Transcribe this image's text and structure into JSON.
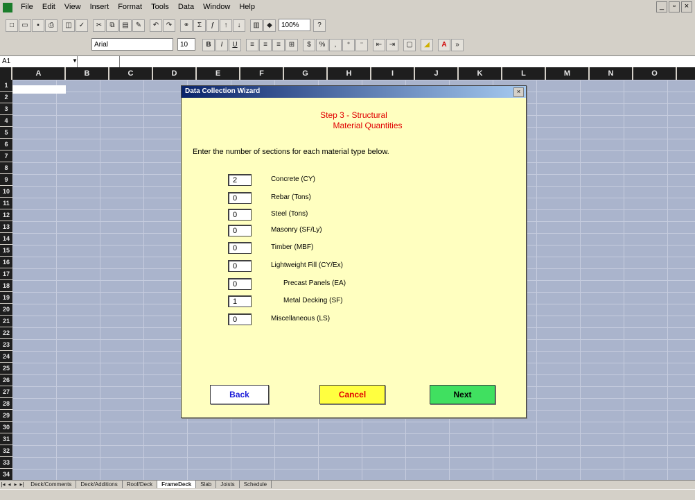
{
  "menubar": {
    "items": [
      "File",
      "Edit",
      "View",
      "Insert",
      "Format",
      "Tools",
      "Data",
      "Window",
      "Help"
    ]
  },
  "toolbar": {
    "zoom": "100%",
    "font_name": "Arial",
    "font_size": "10"
  },
  "formula_bar": {
    "name_box": "A1",
    "value": ""
  },
  "columns": [
    "A",
    "B",
    "C",
    "D",
    "E",
    "F",
    "G",
    "H",
    "I",
    "J",
    "K",
    "L",
    "M",
    "N",
    "O"
  ],
  "rows": [
    "1",
    "2",
    "3",
    "4",
    "5",
    "6",
    "7",
    "8",
    "9",
    "10",
    "11",
    "12",
    "13",
    "14",
    "15",
    "16",
    "17",
    "18",
    "19",
    "20",
    "21",
    "22",
    "23",
    "24",
    "25",
    "26",
    "27",
    "28",
    "29",
    "30",
    "31",
    "32",
    "33",
    "34"
  ],
  "sheet_tabs": {
    "items": [
      "Deck/Comments",
      "Deck/Additions",
      "Roof/Deck",
      "FrameDeck",
      "Slab",
      "Joists",
      "Schedule"
    ],
    "active_index": 3
  },
  "dialog": {
    "title": "Data Collection Wizard",
    "heading_line1": "Step 3 - Structural",
    "heading_line2": "Material Quantities",
    "instructions": "Enter the number of sections for each material type below.",
    "materials": [
      {
        "value": "2",
        "label": "Concrete (CY)"
      },
      {
        "value": "0",
        "label": "Rebar (Tons)"
      },
      {
        "value": "0",
        "label": "Steel (Tons)"
      },
      {
        "value": "0",
        "label": "Masonry (SF/Ly)"
      },
      {
        "value": "0",
        "label": "Timber (MBF)"
      },
      {
        "value": "0",
        "label": "Lightweight Fill (CY/Ex)"
      },
      {
        "value": "0",
        "label": "Precast Panels (EA)"
      },
      {
        "value": "1",
        "label": "Metal Decking (SF)"
      },
      {
        "value": "0",
        "label": "Miscellaneous (LS)"
      }
    ],
    "buttons": {
      "back": "Back",
      "cancel": "Cancel",
      "next": "Next"
    }
  }
}
